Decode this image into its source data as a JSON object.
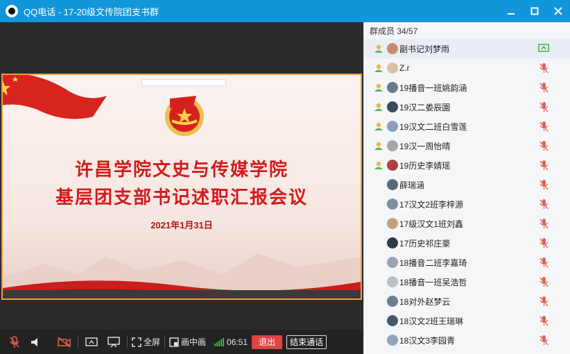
{
  "window": {
    "title": "QQ电话 - 17-20级文传院团支书群"
  },
  "slide": {
    "title_line1": "许昌学院文史与传媒学院",
    "title_line2": "基层团支部书记述职汇报会议",
    "date": "2021年1月31日"
  },
  "controls": {
    "fullscreen_label": "全屏",
    "pip_label": "画中画",
    "timer": "06:51",
    "exit_label": "退出",
    "end_call_label": "结束通话"
  },
  "panel": {
    "header": "群成员 34/57",
    "members": [
      {
        "name": "副书记刘梦雨",
        "status": "admin",
        "right": "screen-share"
      },
      {
        "name": "Z.r",
        "status": "admin",
        "right": "mic-muted"
      },
      {
        "name": "19播音一班姚韵涵",
        "status": "admin",
        "right": "mic-muted"
      },
      {
        "name": "19汉二娄辰園",
        "status": "admin",
        "right": "mic-muted"
      },
      {
        "name": "19汉文二班白雪莲",
        "status": "admin",
        "right": "mic-muted"
      },
      {
        "name": "19汉一周怡晴",
        "status": "admin",
        "right": "mic-muted"
      },
      {
        "name": "19历史李婧瑶",
        "status": "admin",
        "right": "mic-muted"
      },
      {
        "name": "薛瑞涵",
        "status": "",
        "right": "mic-muted"
      },
      {
        "name": "17汉文2班李梓源",
        "status": "",
        "right": "mic-muted"
      },
      {
        "name": "17级汉文1班刘鑫",
        "status": "",
        "right": "mic-muted"
      },
      {
        "name": "17历史祁庄豪",
        "status": "",
        "right": "mic-muted"
      },
      {
        "name": "18播音二班李嘉琦",
        "status": "",
        "right": "mic-muted"
      },
      {
        "name": "18播音一班吴浩哲",
        "status": "",
        "right": "mic-muted"
      },
      {
        "name": "18对外赵梦云",
        "status": "",
        "right": "mic-muted"
      },
      {
        "name": "18汉文2班王瑞琳",
        "status": "",
        "right": "mic-muted"
      },
      {
        "name": "18汉文3李园青",
        "status": "",
        "right": "mic-muted"
      }
    ]
  },
  "colors": {
    "titlebar": "#1296db",
    "accent_orange": "#f29c38",
    "exit_red": "#e04444",
    "slide_red": "#d31b1b",
    "mic_muted": "#e0625a",
    "admin_green": "#5bb85d",
    "screen_share_green": "#3cb34a"
  }
}
